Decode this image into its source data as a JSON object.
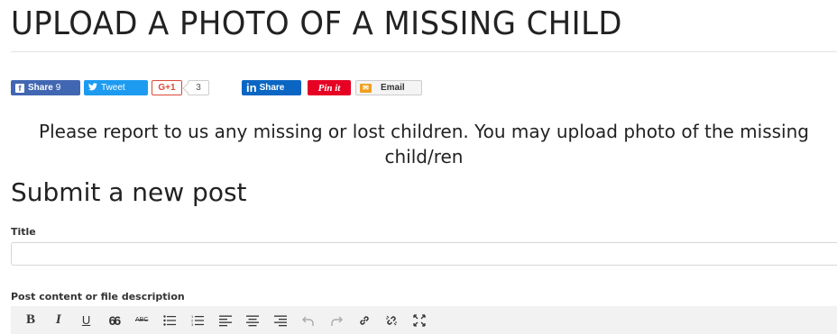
{
  "page": {
    "title": "UPLOAD A PHOTO OF A MISSING CHILD",
    "intro": "Please report to us any missing or lost children. You may upload photo of the missing child/ren",
    "form_heading": "Submit a new post"
  },
  "share": {
    "facebook": {
      "label": "Share",
      "count": "9",
      "icon": "facebook-icon"
    },
    "twitter": {
      "label": "Tweet",
      "icon": "twitter-icon"
    },
    "googleplus": {
      "label": "G+1",
      "count": "3"
    },
    "linkedin": {
      "label": "Share",
      "icon": "linkedin-icon",
      "mark": "in"
    },
    "pinterest": {
      "label": "Pin it"
    },
    "email": {
      "label": "Email",
      "icon": "email-icon"
    }
  },
  "form": {
    "title_label": "Title",
    "title_value": "",
    "content_label": "Post content or file description"
  },
  "toolbar": {
    "bold": "B",
    "italic": "I",
    "underline": "U",
    "blockquote": "66",
    "strikethrough": "ABC"
  },
  "colors": {
    "facebook": "#4267b2",
    "twitter": "#1d9bf0",
    "googleplus": "#dc4a38",
    "linkedin": "#0a66c2",
    "pinterest": "#e60023",
    "email_icon": "#f0a020",
    "toolbar_bg": "#f2f2f2"
  }
}
